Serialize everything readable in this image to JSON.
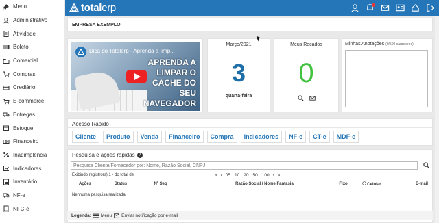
{
  "sidebar": {
    "items": [
      {
        "label": "Menu",
        "icon": "pin-icon"
      },
      {
        "label": "Administrativo",
        "icon": "users-gear-icon"
      },
      {
        "label": "Atividade",
        "icon": "clipboard-icon"
      },
      {
        "label": "Boleto",
        "icon": "barcode-icon"
      },
      {
        "label": "Comercial",
        "icon": "folder-icon"
      },
      {
        "label": "Compras",
        "icon": "cart-icon"
      },
      {
        "label": "Crediário",
        "icon": "credit-card-icon"
      },
      {
        "label": "E-commerce",
        "icon": "shopping-cart-icon"
      },
      {
        "label": "Entregas",
        "icon": "truck-icon"
      },
      {
        "label": "Estoque",
        "icon": "box-icon"
      },
      {
        "label": "Financeiro",
        "icon": "money-icon"
      },
      {
        "label": "Inadimplência",
        "icon": "percent-icon"
      },
      {
        "label": "Indicadores",
        "icon": "chart-icon"
      },
      {
        "label": "Inventário",
        "icon": "list-icon"
      },
      {
        "label": "NF-e",
        "icon": "truck-doc-icon"
      },
      {
        "label": "NFC-e",
        "icon": "receipt-icon"
      }
    ]
  },
  "topbar": {
    "logo_bold": "total",
    "logo_light": "erp",
    "bg_color": "#2576b8"
  },
  "company": {
    "name": "EMPRESA EXEMPLO"
  },
  "video": {
    "title": "Dica do Totalerp - Aprenda a limp...",
    "overlay_lines": [
      "APRENDA A",
      "LIMPAR O",
      "CACHE DO",
      "SEU",
      "NAVEGADOR"
    ]
  },
  "calendar": {
    "month": "Março/2021",
    "day": "3",
    "weekday": "quarta-feira"
  },
  "messages": {
    "title": "Meus Recados",
    "count": "0"
  },
  "notes": {
    "title": "Minhas Anotações",
    "hint": "(0/500 caracteres)"
  },
  "quick": {
    "title": "Acesso Rápido",
    "buttons": [
      "Cliente",
      "Produto",
      "Venda",
      "Financeiro",
      "Compra",
      "Indicadores",
      "NF-e",
      "CT-e",
      "MDF-e"
    ]
  },
  "search": {
    "title": "Pesquisa e ações rápidas",
    "placeholder": "Pesquisa Cliente/Fornecedor por: Nome, Razão Social, CNPJ",
    "records": "Exibindo registro(s) 1 - do total de",
    "page_sizes": [
      "05",
      "10",
      "20",
      "50",
      "100"
    ],
    "columns": [
      "Ações",
      "Status",
      "Nº Seq",
      "Razão Social / Nome Fantasia",
      "Fixo",
      "Celular",
      "E-mail"
    ],
    "empty": "Nenhuma pesquisa realizada"
  },
  "legend": {
    "label": "Legenda:",
    "menu": "Menu",
    "email": "Enviar notificação por e-mail"
  }
}
